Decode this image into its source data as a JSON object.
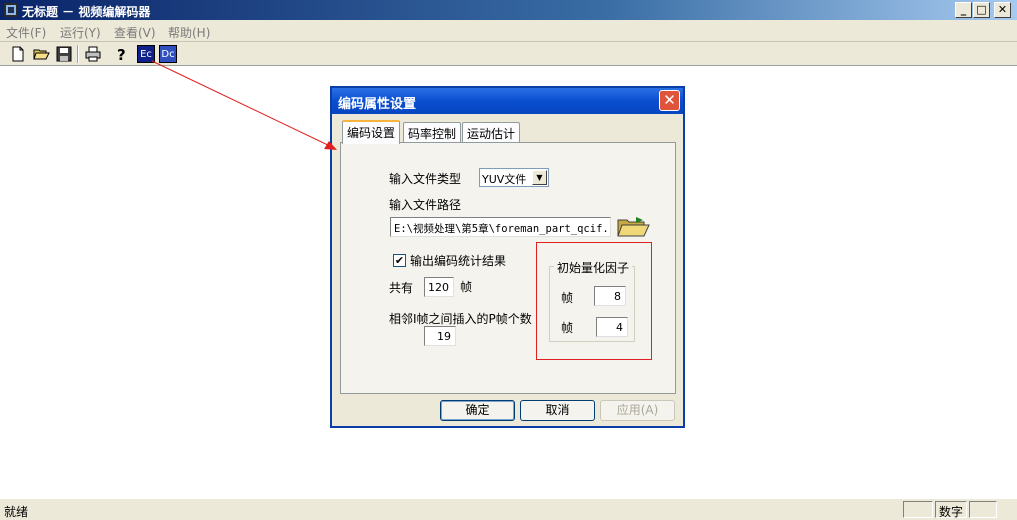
{
  "window": {
    "title": "无标题 － 视频编解码器",
    "controls": {
      "minimize": "_",
      "maximize": "□",
      "close": "✕"
    }
  },
  "menu": [
    "文件(F)",
    "运行(Y)",
    "查看(V)",
    "帮助(H)"
  ],
  "toolbar": {
    "icons": [
      "new-icon",
      "open-icon",
      "save-icon",
      "print-icon",
      "help-icon",
      "encoder-icon",
      "decoder-icon"
    ],
    "encoder_label": "Ec",
    "decoder_label": "Dc"
  },
  "status": {
    "text": "就绪",
    "num_label": "数字"
  },
  "dialog": {
    "title": "编码属性设置",
    "close": "✕",
    "tabs": [
      "编码设置",
      "码率控制",
      "运动估计"
    ],
    "input_type_label": "输入文件类型",
    "input_type_value": "YUV文件",
    "input_path_label": "输入文件路径",
    "input_path_value": "E:\\视频处理\\第5章\\foreman_part_qcif.",
    "output_stats_label": "输出编码统计结果",
    "output_stats_checked": "✔",
    "total_label": "共有",
    "total_value": "120",
    "frames_unit": "帧",
    "p_frames_label": "相邻I帧之间插入的P帧个数",
    "p_frames_value": "19",
    "quant_group_title": "初始量化因子",
    "quant_i_label": "帧",
    "quant_i_value": "8",
    "quant_p_label": "帧",
    "quant_p_value": "4",
    "buttons": {
      "ok": "确定",
      "cancel": "取消",
      "apply": "应用(A)"
    }
  },
  "colors": {
    "title_bar": "#0a246a",
    "dialog_title": "#0a4fd0",
    "annotation": "#e02020",
    "face": "#ece9d8"
  }
}
